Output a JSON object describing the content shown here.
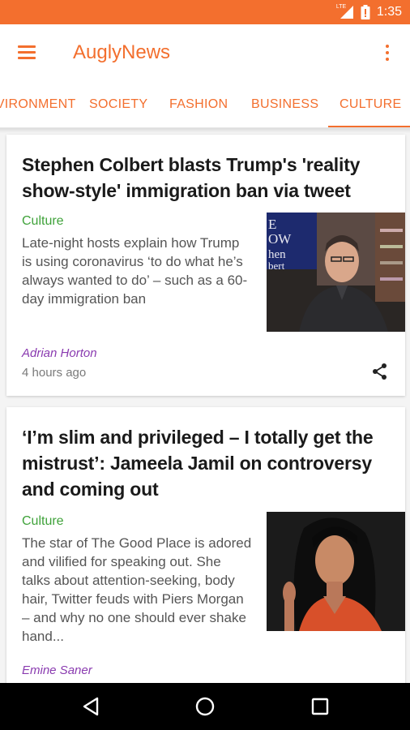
{
  "status_bar": {
    "time": "1:35",
    "network_label": "LTE",
    "icons": [
      "signal-icon",
      "battery-icon"
    ]
  },
  "app_bar": {
    "title": "AuglyNews",
    "menu_icon": "hamburger-menu-icon",
    "overflow_icon": "more-vert-icon"
  },
  "tabs": [
    {
      "label": "ENVIRONMENT"
    },
    {
      "label": "SOCIETY"
    },
    {
      "label": "FASHION"
    },
    {
      "label": "BUSINESS"
    },
    {
      "label": "CULTURE",
      "selected": true
    }
  ],
  "colors": {
    "accent": "#f36f2e",
    "category": "#3fa23a",
    "author": "#8a3bb0",
    "text": "#1a1a1a",
    "excerpt": "#555555"
  },
  "articles": [
    {
      "headline": "Stephen Colbert blasts Trump's 'reality show-style' immigration ban via tweet",
      "category": "Culture",
      "excerpt": "Late-night hosts explain how Trump is using coronavirus ‘to do what he’s always wanted to do’ – such as a 60-day immigration ban",
      "thumb_text": "E\nOW\nhen\nbert",
      "author": "Adrian Horton",
      "time": "4 hours ago"
    },
    {
      "headline": "‘I’m slim and privileged – I totally get the mistrust’: Jameela Jamil on controversy and coming out",
      "category": "Culture",
      "excerpt": "The star of The Good Place is adored and vilified for speaking out. She talks about attention-seeking, body hair, Twitter feuds with Piers Morgan – and why no one should ever shake hand...",
      "author": "Emine Saner"
    }
  ],
  "nav_bar": {
    "icons": [
      "back-icon",
      "home-icon",
      "recents-icon"
    ]
  }
}
